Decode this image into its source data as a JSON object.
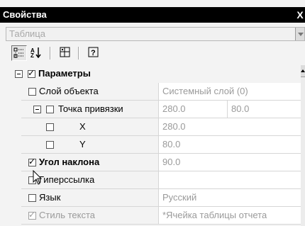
{
  "window": {
    "title": "Свойства",
    "close_glyph": "X"
  },
  "object_selector": {
    "value": "Таблица"
  },
  "toolbar": {
    "buttons": [
      {
        "icon": "categorized-icon",
        "pressed": true
      },
      {
        "icon": "sort-alphabetical-icon",
        "pressed": false
      },
      {
        "icon": "property-pages-icon",
        "pressed": false
      },
      {
        "icon": "help-icon",
        "pressed": false
      }
    ]
  },
  "grid": {
    "group": {
      "label": "Параметры",
      "checked": true,
      "expanded": true
    },
    "rows": [
      {
        "label": "Слой объекта",
        "checked": false,
        "value": "Системный слой (0)"
      },
      {
        "label": "Точка привязки",
        "checked": false,
        "values": [
          "280.0",
          "80.0"
        ]
      },
      {
        "label": "X",
        "checked": false,
        "value": "280.0"
      },
      {
        "label": "Y",
        "checked": false,
        "value": "80.0"
      },
      {
        "label": "Угол наклона",
        "checked": true,
        "value": "90.0"
      },
      {
        "label": "Гиперссылка",
        "checked": false,
        "value": ""
      },
      {
        "label": "Язык",
        "checked": false,
        "value": "Русский"
      },
      {
        "label": "Стиль текста",
        "checked": true,
        "value": "*Ячейка таблицы отчета"
      }
    ]
  },
  "colors": {
    "titlebar_bg": "#000000",
    "titlebar_fg": "#ffffff",
    "value_text": "#9a9a9a",
    "panel_bg": "#f3f3f3"
  }
}
